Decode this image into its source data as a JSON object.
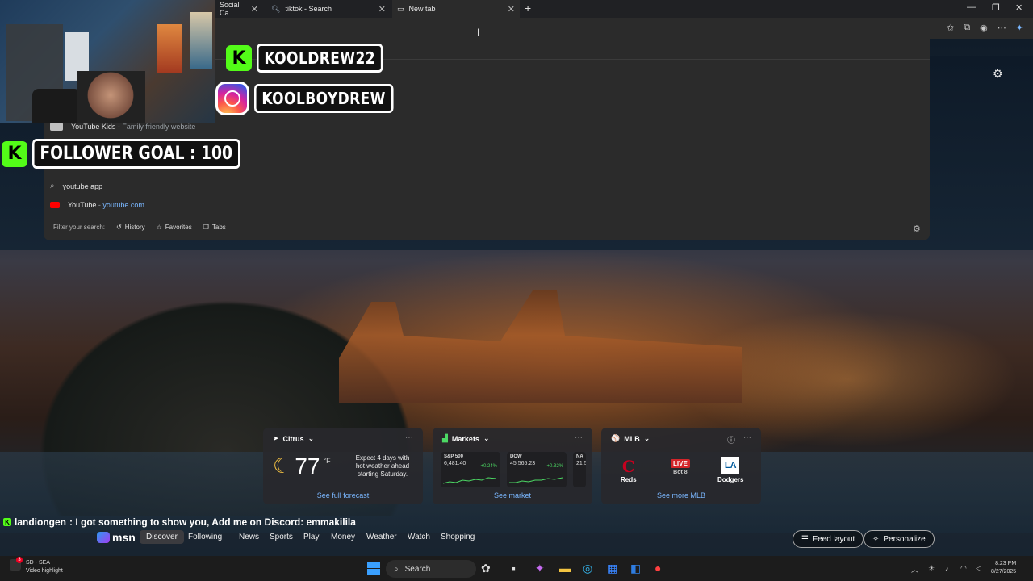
{
  "browser": {
    "tabs": [
      {
        "title": "Social Ca",
        "icon": "tab-favicon"
      },
      {
        "title": "tiktok - Search",
        "icon": "search-icon"
      },
      {
        "title": "New tab",
        "icon": "newtab-icon"
      }
    ],
    "new_tab_label": "+"
  },
  "stream_overlay": {
    "kick_handle": "KOOLDREW22",
    "instagram_handle": "KOOLBOYDREW",
    "follower_goal": "FOLLOWER GOAL : 100",
    "kick_letter": "K"
  },
  "dropdown": {
    "suggestions": [
      {
        "title": "YouTube Kids",
        "sep": " - ",
        "detail": "Family friendly website",
        "icon": "youtube-kids-icon"
      },
      {
        "title": "youtube app",
        "icon": "search-icon"
      },
      {
        "title": "YouTube",
        "sep": " - ",
        "detail": "youtube.com",
        "icon": "youtube-icon"
      }
    ],
    "filter_label": "Filter your search:",
    "filters": [
      "History",
      "Favorites",
      "Tabs"
    ]
  },
  "widgets": {
    "weather": {
      "location": "Citrus",
      "temperature": "77",
      "unit": "°F",
      "forecast": "Expect 4 days with hot weather ahead starting Saturday.",
      "link": "See full forecast"
    },
    "markets": {
      "title": "Markets",
      "items": [
        {
          "name": "S&P 500",
          "value": "6,481.40",
          "change": "+0.24%"
        },
        {
          "name": "DOW",
          "value": "45,565.23",
          "change": "+0.32%"
        },
        {
          "name": "NA",
          "value": "21,5",
          "change": ""
        }
      ],
      "link": "See market"
    },
    "mlb": {
      "title": "MLB",
      "home": "Reds",
      "away": "Dodgers",
      "status": "LIVE",
      "inning": "Bot 8",
      "link": "See more MLB"
    }
  },
  "chat": {
    "user": "landiongen",
    "message": ": I got something to show you, Add me on Discord: emmakilila"
  },
  "msn": {
    "logo": "msn",
    "nav": [
      "Discover",
      "Following",
      "News",
      "Sports",
      "Play",
      "Money",
      "Weather",
      "Watch",
      "Shopping"
    ],
    "feed_layout": "Feed layout",
    "personalize": "Personalize"
  },
  "taskbar": {
    "notification_title": "SD - SEA",
    "notification_sub": "Video highlight",
    "notification_count": "3",
    "search_label": "Search",
    "time": "8:23 PM",
    "date": "8/27/2025"
  }
}
